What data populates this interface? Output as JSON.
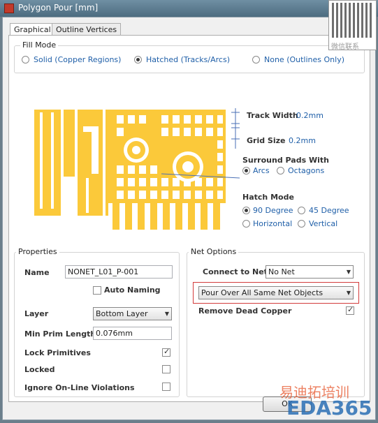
{
  "window": {
    "title": "Polygon Pour [mm]"
  },
  "watermark_qr": {
    "caption": "微信联系"
  },
  "tabs": [
    "Graphical",
    "Outline Vertices"
  ],
  "fill_mode": {
    "title": "Fill Mode",
    "options": [
      "Solid (Copper Regions)",
      "Hatched (Tracks/Arcs)",
      "None (Outlines Only)"
    ],
    "selected": "Hatched (Tracks/Arcs)"
  },
  "graphic": {
    "track_width_label": "Track Width",
    "track_width_value": "0.2mm",
    "grid_size_label": "Grid Size",
    "grid_size_value": "0.2mm",
    "surround_label": "Surround Pads With",
    "surround_options": [
      "Arcs",
      "Octagons"
    ],
    "surround_selected": "Arcs",
    "hatch_mode_label": "Hatch Mode",
    "hatch_options": [
      "90 Degree",
      "45 Degree",
      "Horizontal",
      "Vertical"
    ],
    "hatch_selected": "90 Degree",
    "copper_color": "#fbc93a"
  },
  "properties": {
    "title": "Properties",
    "name_label": "Name",
    "name_value": "NONET_L01_P-001",
    "auto_naming_label": "Auto Naming",
    "auto_naming": false,
    "layer_label": "Layer",
    "layer_value": "Bottom Layer",
    "min_prim_label": "Min Prim Length",
    "min_prim_value": "0.076mm",
    "lock_primitives_label": "Lock Primitives",
    "lock_primitives": true,
    "locked_label": "Locked",
    "locked": false,
    "ignore_label": "Ignore On-Line Violations",
    "ignore": false
  },
  "net_options": {
    "title": "Net Options",
    "connect_label": "Connect to Net",
    "connect_value": "No Net",
    "pour_value": "Pour Over All Same Net Objects",
    "remove_dead_label": "Remove Dead Copper",
    "remove_dead": true
  },
  "footer": {
    "ok_label": "OK"
  },
  "brand_watermark": {
    "text": "EDA365",
    "subtitle": "易迪拓培训"
  }
}
